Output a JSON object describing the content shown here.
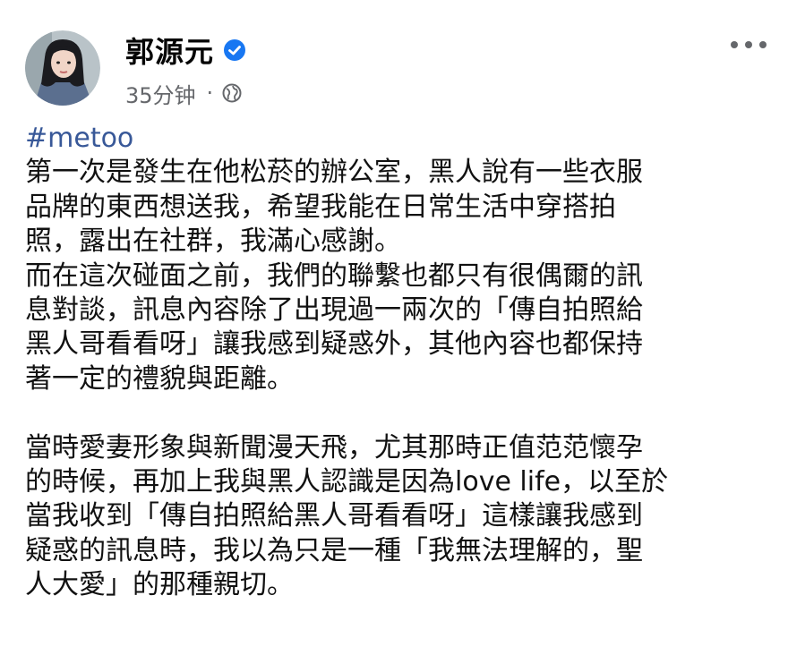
{
  "post": {
    "author": "郭源元",
    "time": "35分钟",
    "dot": "·",
    "hashtag": "#metoo",
    "paragraph1": [
      "第一次是發生在他松菸的辦公室，黑人說有一些衣服",
      "品牌的東西想送我，希望我能在日常生活中穿搭拍",
      "照，露出在社群，我滿心感謝。",
      "而在這次碰面之前，我們的聯繫也都只有很偶爾的訊",
      "息對談，訊息內容除了出現過一兩次的「傳自拍照給",
      "黑人哥看看呀」讓我感到疑惑外，其他內容也都保持",
      "著一定的禮貌與距離。"
    ],
    "paragraph2": [
      "當時愛妻形象與新聞漫天飛，尤其那時正值范范懷孕",
      "的時候，再加上我與黑人認識是因為love life，以至於",
      "當我收到「傳自拍照給黑人哥看看呀」這樣讓我感到",
      "疑惑的訊息時，我以為只是一種「我無法理解的，聖",
      "人大愛」的那種親切。"
    ]
  },
  "icons": {
    "verified": "verified-badge-icon",
    "audience": "globe-icon",
    "menu": "more-options-icon"
  },
  "colors": {
    "hashtag": "#385898",
    "verified": "#1877f2",
    "meta": "#65676b"
  }
}
